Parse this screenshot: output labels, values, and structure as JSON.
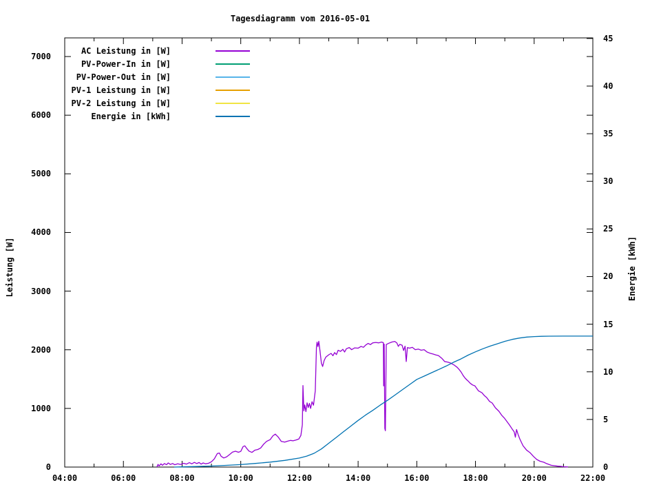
{
  "title": "Tagesdiagramm vom 2016-05-01",
  "axes": {
    "y_left_label": "Leistung [W]",
    "y_right_label": "Energie [kWh]",
    "x_ticks": [
      {
        "t": 4,
        "label": "04:00"
      },
      {
        "t": 6,
        "label": "06:00"
      },
      {
        "t": 8,
        "label": "08:00"
      },
      {
        "t": 10,
        "label": "10:00"
      },
      {
        "t": 12,
        "label": "12:00"
      },
      {
        "t": 14,
        "label": "14:00"
      },
      {
        "t": 16,
        "label": "16:00"
      },
      {
        "t": 18,
        "label": "18:00"
      },
      {
        "t": 20,
        "label": "20:00"
      },
      {
        "t": 22,
        "label": "22:00"
      }
    ],
    "x_minor_hours": [
      5,
      7,
      9,
      11,
      13,
      15,
      17,
      19,
      21
    ],
    "y_left_ticks": [
      {
        "v": 0,
        "label": "0"
      },
      {
        "v": 1000,
        "label": "1000"
      },
      {
        "v": 2000,
        "label": "2000"
      },
      {
        "v": 3000,
        "label": "3000"
      },
      {
        "v": 4000,
        "label": "4000"
      },
      {
        "v": 5000,
        "label": "5000"
      },
      {
        "v": 6000,
        "label": "6000"
      },
      {
        "v": 7000,
        "label": "7000"
      }
    ],
    "y_right_ticks": [
      {
        "v": 0,
        "label": "0"
      },
      {
        "v": 5,
        "label": "5"
      },
      {
        "v": 10,
        "label": "10"
      },
      {
        "v": 15,
        "label": "15"
      },
      {
        "v": 20,
        "label": "20"
      },
      {
        "v": 25,
        "label": "25"
      },
      {
        "v": 30,
        "label": "30"
      },
      {
        "v": 35,
        "label": "35"
      },
      {
        "v": 40,
        "label": "40"
      },
      {
        "v": 45,
        "label": "45"
      }
    ]
  },
  "legend": [
    {
      "label": "AC Leistung in [W]",
      "color": "#9400D3"
    },
    {
      "label": "PV-Power-In in [W]",
      "color": "#009E73"
    },
    {
      "label": "PV-Power-Out in [W]",
      "color": "#56B4E9"
    },
    {
      "label": "PV-1 Leistung in [W]",
      "color": "#E69F00"
    },
    {
      "label": "PV-2 Leistung in [W]",
      "color": "#F0E442"
    },
    {
      "label": "Energie in [kWh]",
      "color": "#0072B2"
    }
  ],
  "chart_data": {
    "type": "line",
    "title": "Tagesdiagramm vom 2016-05-01",
    "xlabel": "",
    "ylabel_left": "Leistung [W]",
    "ylabel_right": "Energie [kWh]",
    "xlim_hours": [
      4,
      22
    ],
    "ylim_left": [
      0,
      7318
    ],
    "ylim_right": [
      0,
      45.06
    ],
    "grid": false,
    "legend_position": "top-left",
    "series": [
      {
        "name": "AC Leistung in [W]",
        "color": "#9400D3",
        "axis": "left",
        "points": [
          [
            7.14,
            0
          ],
          [
            7.18,
            45
          ],
          [
            7.22,
            20
          ],
          [
            7.28,
            55
          ],
          [
            7.33,
            30
          ],
          [
            7.4,
            60
          ],
          [
            7.47,
            40
          ],
          [
            7.53,
            70
          ],
          [
            7.6,
            45
          ],
          [
            7.68,
            60
          ],
          [
            7.75,
            40
          ],
          [
            7.85,
            55
          ],
          [
            7.95,
            45
          ],
          [
            8.05,
            65
          ],
          [
            8.15,
            50
          ],
          [
            8.25,
            75
          ],
          [
            8.33,
            55
          ],
          [
            8.42,
            80
          ],
          [
            8.5,
            60
          ],
          [
            8.58,
            78
          ],
          [
            8.65,
            50
          ],
          [
            8.72,
            70
          ],
          [
            8.8,
            55
          ],
          [
            8.9,
            65
          ],
          [
            9.0,
            90
          ],
          [
            9.1,
            140
          ],
          [
            9.2,
            230
          ],
          [
            9.27,
            240
          ],
          [
            9.33,
            185
          ],
          [
            9.42,
            155
          ],
          [
            9.52,
            175
          ],
          [
            9.62,
            215
          ],
          [
            9.72,
            255
          ],
          [
            9.82,
            270
          ],
          [
            9.92,
            252
          ],
          [
            10.0,
            268
          ],
          [
            10.08,
            350
          ],
          [
            10.14,
            362
          ],
          [
            10.2,
            320
          ],
          [
            10.28,
            272
          ],
          [
            10.38,
            250
          ],
          [
            10.48,
            288
          ],
          [
            10.58,
            300
          ],
          [
            10.68,
            325
          ],
          [
            10.78,
            390
          ],
          [
            10.88,
            438
          ],
          [
            11.0,
            468
          ],
          [
            11.1,
            535
          ],
          [
            11.18,
            562
          ],
          [
            11.28,
            510
          ],
          [
            11.38,
            438
          ],
          [
            11.5,
            425
          ],
          [
            11.6,
            442
          ],
          [
            11.7,
            455
          ],
          [
            11.78,
            448
          ],
          [
            11.88,
            462
          ],
          [
            11.98,
            478
          ],
          [
            12.05,
            540
          ],
          [
            12.1,
            720
          ],
          [
            12.12,
            1390
          ],
          [
            12.15,
            960
          ],
          [
            12.18,
            1060
          ],
          [
            12.22,
            945
          ],
          [
            12.26,
            1095
          ],
          [
            12.3,
            1015
          ],
          [
            12.34,
            1085
          ],
          [
            12.38,
            1000
          ],
          [
            12.43,
            1115
          ],
          [
            12.48,
            1055
          ],
          [
            12.54,
            1300
          ],
          [
            12.58,
            2050
          ],
          [
            12.6,
            2130
          ],
          [
            12.63,
            2055
          ],
          [
            12.66,
            2145
          ],
          [
            12.7,
            1985
          ],
          [
            12.75,
            1770
          ],
          [
            12.79,
            1715
          ],
          [
            12.84,
            1815
          ],
          [
            12.9,
            1875
          ],
          [
            13.0,
            1915
          ],
          [
            13.08,
            1938
          ],
          [
            13.14,
            1898
          ],
          [
            13.2,
            1952
          ],
          [
            13.26,
            1918
          ],
          [
            13.32,
            1992
          ],
          [
            13.4,
            1972
          ],
          [
            13.48,
            2008
          ],
          [
            13.54,
            1962
          ],
          [
            13.6,
            2018
          ],
          [
            13.7,
            2038
          ],
          [
            13.78,
            2002
          ],
          [
            13.88,
            2032
          ],
          [
            14.0,
            2028
          ],
          [
            14.1,
            2058
          ],
          [
            14.18,
            2042
          ],
          [
            14.26,
            2082
          ],
          [
            14.34,
            2108
          ],
          [
            14.42,
            2088
          ],
          [
            14.5,
            2118
          ],
          [
            14.6,
            2125
          ],
          [
            14.7,
            2118
          ],
          [
            14.8,
            2132
          ],
          [
            14.86,
            2120
          ],
          [
            14.87,
            1385
          ],
          [
            14.89,
            2095
          ],
          [
            14.91,
            660
          ],
          [
            14.93,
            620
          ],
          [
            14.96,
            2090
          ],
          [
            15.05,
            2112
          ],
          [
            15.15,
            2132
          ],
          [
            15.25,
            2142
          ],
          [
            15.32,
            2115
          ],
          [
            15.37,
            2058
          ],
          [
            15.42,
            2092
          ],
          [
            15.5,
            2078
          ],
          [
            15.55,
            1988
          ],
          [
            15.6,
            2062
          ],
          [
            15.64,
            1800
          ],
          [
            15.68,
            2038
          ],
          [
            15.75,
            2028
          ],
          [
            15.85,
            2042
          ],
          [
            15.95,
            2002
          ],
          [
            16.05,
            2012
          ],
          [
            16.15,
            1992
          ],
          [
            16.25,
            2002
          ],
          [
            16.35,
            1962
          ],
          [
            16.45,
            1942
          ],
          [
            16.55,
            1928
          ],
          [
            16.65,
            1912
          ],
          [
            16.74,
            1900
          ],
          [
            16.85,
            1855
          ],
          [
            16.95,
            1800
          ],
          [
            17.05,
            1790
          ],
          [
            17.15,
            1775
          ],
          [
            17.28,
            1737
          ],
          [
            17.38,
            1700
          ],
          [
            17.45,
            1660
          ],
          [
            17.51,
            1620
          ],
          [
            17.58,
            1560
          ],
          [
            17.65,
            1515
          ],
          [
            17.72,
            1480
          ],
          [
            17.75,
            1467
          ],
          [
            17.82,
            1430
          ],
          [
            17.9,
            1400
          ],
          [
            17.98,
            1385
          ],
          [
            18.1,
            1300
          ],
          [
            18.22,
            1268
          ],
          [
            18.3,
            1220
          ],
          [
            18.38,
            1186
          ],
          [
            18.48,
            1120
          ],
          [
            18.57,
            1092
          ],
          [
            18.68,
            1010
          ],
          [
            18.8,
            951
          ],
          [
            18.9,
            880
          ],
          [
            18.99,
            833
          ],
          [
            19.08,
            770
          ],
          [
            19.16,
            716
          ],
          [
            19.25,
            650
          ],
          [
            19.32,
            600
          ],
          [
            19.36,
            510
          ],
          [
            19.4,
            640
          ],
          [
            19.45,
            560
          ],
          [
            19.51,
            480
          ],
          [
            19.62,
            364
          ],
          [
            19.74,
            290
          ],
          [
            19.86,
            246
          ],
          [
            19.98,
            180
          ],
          [
            20.09,
            129
          ],
          [
            20.2,
            100
          ],
          [
            20.33,
            82
          ],
          [
            20.42,
            60
          ],
          [
            20.49,
            47
          ],
          [
            20.58,
            30
          ],
          [
            20.68,
            23
          ],
          [
            20.8,
            15
          ],
          [
            20.91,
            12
          ],
          [
            21.0,
            6
          ],
          [
            21.15,
            2
          ]
        ]
      },
      {
        "name": "PV-Power-In in [W]",
        "color": "#009E73",
        "axis": "left",
        "points": []
      },
      {
        "name": "PV-Power-Out in [W]",
        "color": "#56B4E9",
        "axis": "left",
        "points": []
      },
      {
        "name": "PV-1 Leistung in [W]",
        "color": "#E69F00",
        "axis": "left",
        "points": []
      },
      {
        "name": "PV-2 Leistung in [W]",
        "color": "#F0E442",
        "axis": "left",
        "points": []
      },
      {
        "name": "Energie in [kWh]",
        "color": "#0072B2",
        "axis": "right",
        "points": [
          [
            7.73,
            0
          ],
          [
            8.0,
            0.02
          ],
          [
            8.5,
            0.06
          ],
          [
            9.0,
            0.11
          ],
          [
            9.5,
            0.18
          ],
          [
            10.0,
            0.26
          ],
          [
            10.5,
            0.38
          ],
          [
            11.0,
            0.52
          ],
          [
            11.5,
            0.7
          ],
          [
            12.0,
            0.95
          ],
          [
            12.25,
            1.15
          ],
          [
            12.5,
            1.45
          ],
          [
            12.75,
            1.9
          ],
          [
            13.0,
            2.5
          ],
          [
            13.25,
            3.1
          ],
          [
            13.5,
            3.7
          ],
          [
            13.75,
            4.3
          ],
          [
            14.0,
            4.9
          ],
          [
            14.25,
            5.45
          ],
          [
            14.5,
            5.95
          ],
          [
            14.75,
            6.5
          ],
          [
            15.0,
            7.0
          ],
          [
            15.25,
            7.55
          ],
          [
            15.5,
            8.1
          ],
          [
            15.75,
            8.65
          ],
          [
            16.0,
            9.2
          ],
          [
            16.25,
            9.55
          ],
          [
            16.5,
            9.9
          ],
          [
            16.75,
            10.25
          ],
          [
            17.0,
            10.6
          ],
          [
            17.25,
            11.0
          ],
          [
            17.5,
            11.35
          ],
          [
            17.75,
            11.75
          ],
          [
            18.0,
            12.1
          ],
          [
            18.25,
            12.42
          ],
          [
            18.5,
            12.7
          ],
          [
            18.75,
            12.95
          ],
          [
            19.0,
            13.2
          ],
          [
            19.25,
            13.4
          ],
          [
            19.5,
            13.55
          ],
          [
            19.75,
            13.65
          ],
          [
            20.0,
            13.7
          ],
          [
            20.25,
            13.73
          ],
          [
            20.5,
            13.74
          ],
          [
            21.0,
            13.75
          ],
          [
            21.5,
            13.75
          ],
          [
            22.0,
            13.75
          ]
        ]
      }
    ]
  }
}
